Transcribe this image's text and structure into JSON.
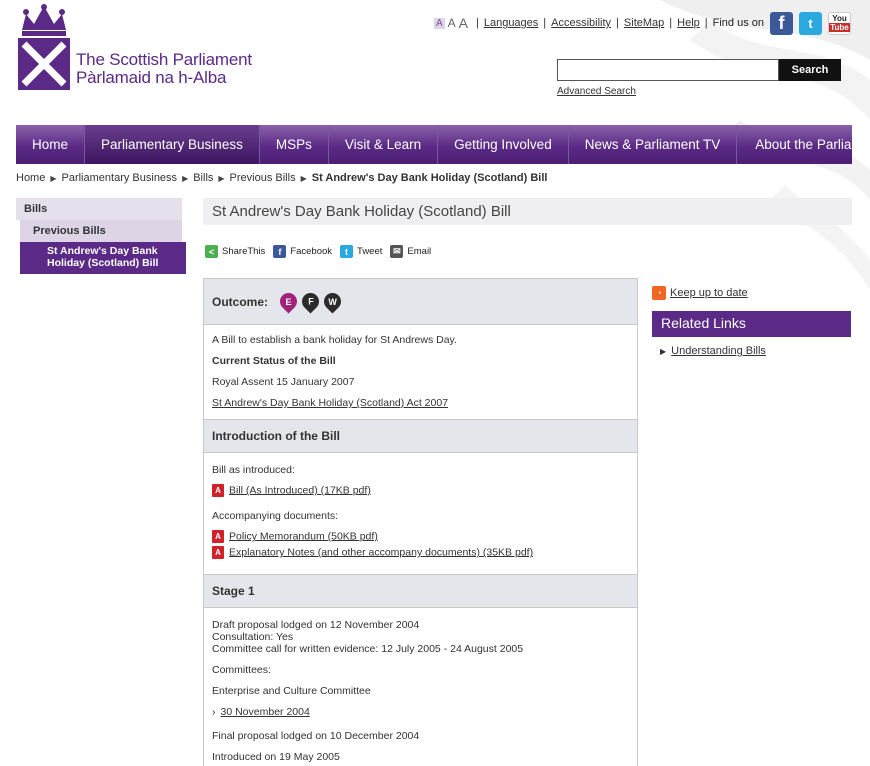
{
  "logo": {
    "line1": "The Scottish Parliament",
    "line2": "Pàrlamaid na h-Alba"
  },
  "utility": {
    "text_sizes": [
      "A",
      "A",
      "A"
    ],
    "links": [
      "Languages",
      "Accessibility",
      "SiteMap",
      "Help"
    ],
    "find_us": "Find us on",
    "youtube_top": "You",
    "youtube_bottom": "Tube"
  },
  "search": {
    "button": "Search",
    "advanced": "Advanced Search"
  },
  "nav": [
    "Home",
    "Parliamentary Business",
    "MSPs",
    "Visit & Learn",
    "Getting Involved",
    "News & Parliament TV",
    "About the Parliament"
  ],
  "breadcrumb": [
    "Home",
    "Parliamentary Business",
    "Bills",
    "Previous Bills",
    "St Andrew's Day Bank Holiday (Scotland) Bill"
  ],
  "left_nav": {
    "level1": "Bills",
    "level2": "Previous Bills",
    "current_line1": "St Andrew's Day Bank",
    "current_line2": "Holiday (Scotland) Bill"
  },
  "page_title": "St Andrew's Day Bank Holiday (Scotland) Bill",
  "share": [
    "ShareThis",
    "Facebook",
    "Tweet",
    "Email"
  ],
  "outcome": {
    "label": "Outcome:",
    "badges": [
      "E",
      "F",
      "W"
    ],
    "description": "A Bill to establish a bank holiday for St Andrews Day.",
    "status_label": "Current Status of the Bill",
    "status": "Royal Assent 15 January 2007",
    "act_link": "St Andrew's Day Bank Holiday (Scotland) Act 2007"
  },
  "introduction": {
    "heading": "Introduction of the Bill",
    "as_introduced_label": "Bill as introduced:",
    "bill_pdf": "Bill (As Introduced) (17KB pdf)",
    "accompanying_label": "Accompanying documents:",
    "docs": [
      "Policy Memorandum (50KB pdf)",
      "Explanatory Notes (and other accompany documents) (35KB pdf)"
    ]
  },
  "stage1": {
    "heading": "Stage 1",
    "draft": "Draft proposal lodged on 12 November 2004",
    "consultation": "Consultation: Yes",
    "call": "Committee call for written evidence: 12 July 2005 - 24 August 2005",
    "committees_label": "Committees:",
    "committee": "Enterprise and Culture Committee",
    "meeting": "30 November 2004",
    "final": "Final proposal lodged on 10 December 2004",
    "introduced": "Introduced on 19 May 2005"
  },
  "sidebar": {
    "keep_up": "Keep up to date",
    "related_heading": "Related Links",
    "related_items": [
      "Understanding Bills"
    ]
  },
  "colors": {
    "purple": "#5b2a86",
    "badge_e": "#a0237a",
    "badge_dark": "#2b2b2b"
  }
}
